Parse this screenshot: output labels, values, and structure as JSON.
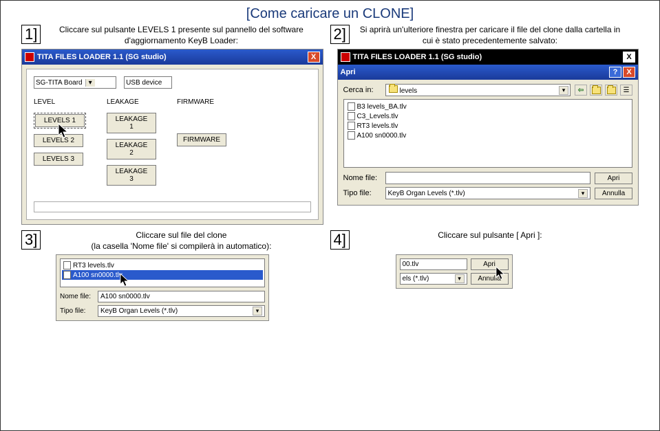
{
  "title": "[Come caricare un CLONE]",
  "steps": {
    "s1": {
      "num": "1]",
      "text": "Cliccare sul pulsante LEVELS 1 presente sul pannello del software d'aggiornamento KeyB Loader:"
    },
    "s2": {
      "num": "2]",
      "text": "Si aprirà un'ulteriore finestra per caricare il file del clone dalla cartella in cui è stato precedentemente salvato:"
    },
    "s3": {
      "num": "3]",
      "text": "Cliccare sul file del clone\n(la casella 'Nome file' si compilerà in automatico):"
    },
    "s4": {
      "num": "4]",
      "text": "Cliccare sul pulsante [ Apri ]:"
    }
  },
  "loader": {
    "title": "TITA FILES LOADER 1.1 (SG studio)",
    "board": "SG-TITA Board",
    "device": "USB device",
    "sec_level": "LEVEL",
    "sec_leakage": "LEAKAGE",
    "sec_firmware": "FIRMWARE",
    "btn_l1": "LEVELS 1",
    "btn_l2": "LEVELS 2",
    "btn_l3": "LEVELS 3",
    "btn_lk1": "LEAKAGE 1",
    "btn_lk2": "LEAKAGE 2",
    "btn_lk3": "LEAKAGE 3",
    "btn_fw": "FIRMWARE"
  },
  "opendlg": {
    "title": "TITA FILES LOADER 1.1 (SG studio)",
    "subtitle": "Apri",
    "search_in": "Cerca in:",
    "folder": "levels",
    "files": [
      "B3 levels_BA.tlv",
      "C3_Levels.tlv",
      "RT3 levels.tlv",
      "A100 sn0000.tlv"
    ],
    "name_label": "Nome file:",
    "type_label": "Tipo file:",
    "type_value": "KeyB Organ Levels (*.tlv)",
    "btn_open": "Apri",
    "btn_cancel": "Annulla"
  },
  "step3shot": {
    "files": [
      "RT3 levels.tlv",
      "A100 sn0000.tlv"
    ],
    "name_label": "Nome file:",
    "name_value": "A100 sn0000.tlv",
    "type_label": "Tipo file:",
    "type_value": "KeyB Organ Levels (*.tlv)"
  },
  "step4shot": {
    "row1_text": "00.tlv",
    "row2_text": "els (*.tlv)",
    "btn_open": "Apri",
    "btn_cancel": "Annulla"
  },
  "glyphs": {
    "x": "X",
    "q": "?",
    "down": "▾",
    "left": "⇦"
  }
}
